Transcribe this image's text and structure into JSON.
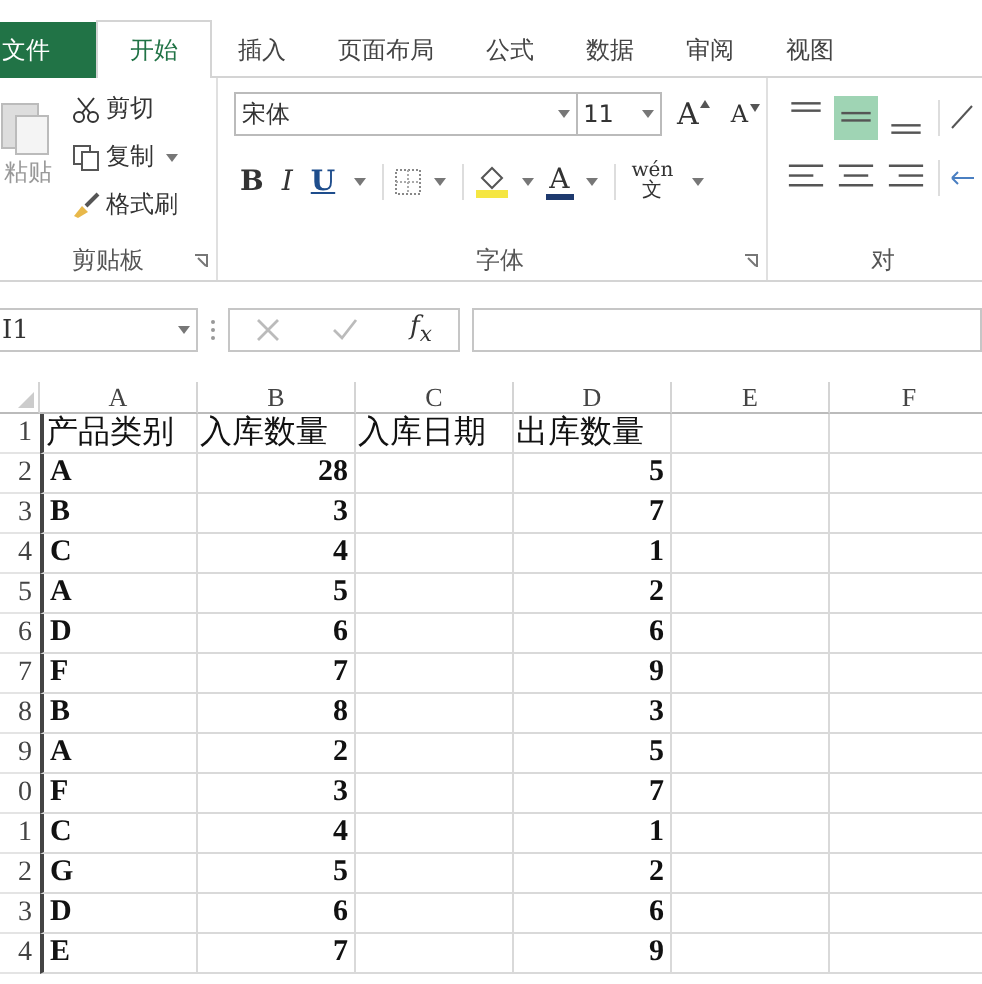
{
  "tabs": [
    {
      "label": "文件",
      "kind": "file",
      "selected": false
    },
    {
      "label": "开始",
      "kind": "tab",
      "selected": true
    },
    {
      "label": "插入",
      "kind": "tab",
      "selected": false
    },
    {
      "label": "页面布局",
      "kind": "tab",
      "selected": false
    },
    {
      "label": "公式",
      "kind": "tab",
      "selected": false
    },
    {
      "label": "数据",
      "kind": "tab",
      "selected": false
    },
    {
      "label": "审阅",
      "kind": "tab",
      "selected": false
    },
    {
      "label": "视图",
      "kind": "tab",
      "selected": false
    }
  ],
  "clipboard": {
    "paste": "粘贴",
    "cut": "剪切",
    "copy": "复制",
    "format_painter": "格式刷",
    "group_label": "剪贴板"
  },
  "font": {
    "font_name": "宋体",
    "font_size": "11",
    "grow": "A",
    "shrink": "A",
    "style_buttons": [
      {
        "label": "B",
        "kind": "bold"
      },
      {
        "label": "I",
        "kind": "italic"
      },
      {
        "label": "U",
        "kind": "underline"
      }
    ],
    "font_color": "A",
    "phonetic_top": "wén",
    "phonetic_bottom": "文",
    "group_label": "字体"
  },
  "alignment": {
    "vertical": [
      {
        "kind": "top",
        "selected": false
      },
      {
        "kind": "middle",
        "selected": true
      },
      {
        "kind": "bottom",
        "selected": false
      }
    ],
    "horizontal": [
      {
        "kind": "left",
        "selected": false
      },
      {
        "kind": "center",
        "selected": false
      },
      {
        "kind": "right",
        "selected": false
      }
    ],
    "group_label": "对"
  },
  "formula_bar": {
    "name_box": "I1",
    "fx": "f$_{x}$"
  },
  "sheet": {
    "columns": [
      "A",
      "B",
      "C",
      "D",
      "E",
      "F"
    ],
    "header_row": {
      "number": "1",
      "cells": [
        "产品类别",
        "入库数量",
        "入库日期",
        "出库数量"
      ]
    },
    "rows": [
      {
        "number": "2",
        "category": "A",
        "in_qty": "28",
        "out_qty": "5"
      },
      {
        "number": "3",
        "category": "B",
        "in_qty": "3",
        "out_qty": "7"
      },
      {
        "number": "4",
        "category": "C",
        "in_qty": "4",
        "out_qty": "1"
      },
      {
        "number": "5",
        "category": "A",
        "in_qty": "5",
        "out_qty": "2"
      },
      {
        "number": "6",
        "category": "D",
        "in_qty": "6",
        "out_qty": "6"
      },
      {
        "number": "7",
        "category": "F",
        "in_qty": "7",
        "out_qty": "9"
      },
      {
        "number": "8",
        "category": "B",
        "in_qty": "8",
        "out_qty": "3"
      },
      {
        "number": "9",
        "category": "A",
        "in_qty": "2",
        "out_qty": "5"
      },
      {
        "number": "0",
        "category": "F",
        "in_qty": "3",
        "out_qty": "7"
      },
      {
        "number": "1",
        "category": "C",
        "in_qty": "4",
        "out_qty": "1"
      },
      {
        "number": "2",
        "category": "G",
        "in_qty": "5",
        "out_qty": "2"
      },
      {
        "number": "3",
        "category": "D",
        "in_qty": "6",
        "out_qty": "6"
      },
      {
        "number": "4",
        "category": "E",
        "in_qty": "7",
        "out_qty": "9"
      }
    ]
  }
}
